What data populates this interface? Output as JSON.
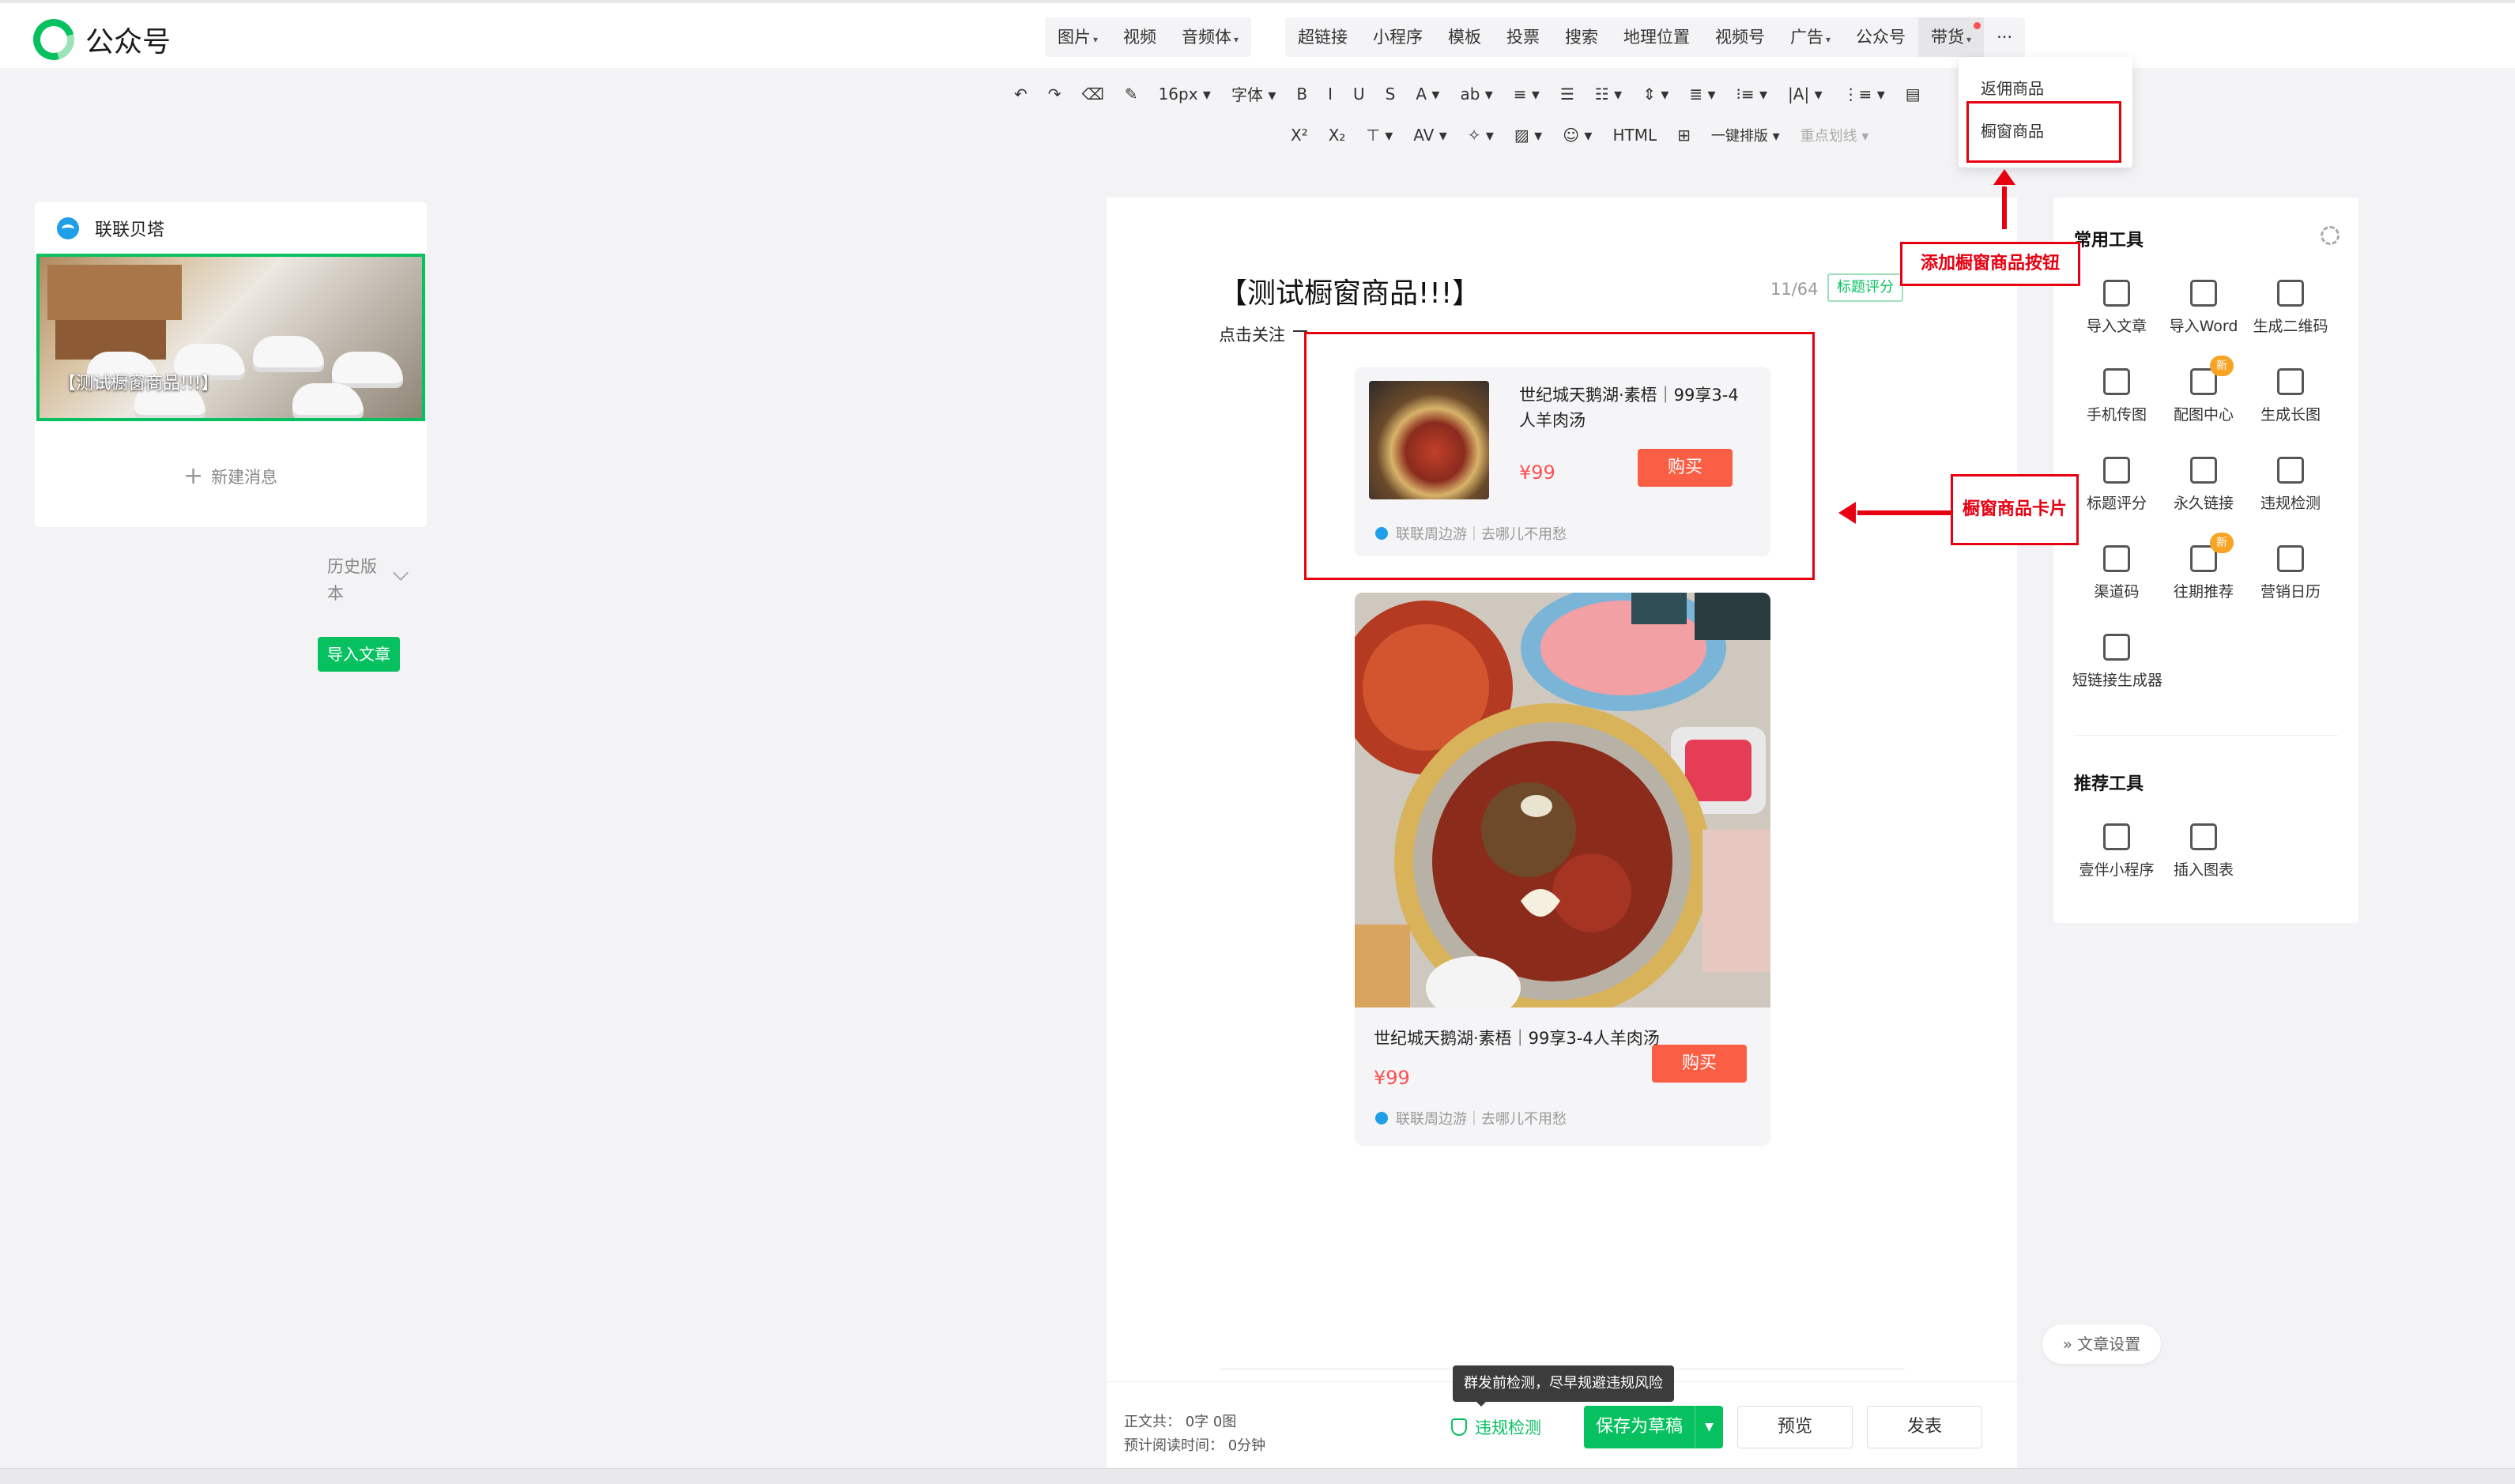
{
  "app": {
    "name": "公众号"
  },
  "nav": {
    "group1": [
      {
        "label": "图片",
        "caret": true
      },
      {
        "label": "视频",
        "caret": false
      },
      {
        "label": "音频体",
        "caret": true
      }
    ],
    "group2": [
      {
        "label": "超链接",
        "caret": false
      },
      {
        "label": "小程序",
        "caret": false
      },
      {
        "label": "模板",
        "caret": false
      },
      {
        "label": "投票",
        "caret": false
      },
      {
        "label": "搜索",
        "caret": false
      },
      {
        "label": "地理位置",
        "caret": false
      },
      {
        "label": "视频号",
        "caret": false
      },
      {
        "label": "广告",
        "caret": true
      },
      {
        "label": "公众号",
        "caret": false
      },
      {
        "label": "带货",
        "caret": true
      },
      {
        "label": "···",
        "caret": false
      }
    ]
  },
  "toolbar": {
    "row1": [
      "↶",
      "↷",
      "⌫",
      "✎",
      "16px ▾",
      "字体 ▾",
      "B",
      "I",
      "U",
      "S",
      "A ▾",
      "ab ▾",
      "≡ ▾",
      "☰",
      "☷ ▾",
      "⇕ ▾",
      "≣ ▾",
      "⁝≡ ▾",
      "|A| ▾",
      "⋮≡ ▾",
      "▤"
    ],
    "row2": [
      "X²",
      "X₂",
      "⊤ ▾",
      "AV ▾",
      "✧ ▾",
      "▨ ▾",
      "☺ ▾",
      "HTML",
      "⊞"
    ],
    "autolayout": "一键排版 ▾",
    "highlight": "重点划线 ▾"
  },
  "dropdown": {
    "items": [
      "返佣商品",
      "橱窗商品"
    ]
  },
  "left": {
    "account": "联联贝塔",
    "thumb_title": "【测试橱窗商品!!!】",
    "new_message": "新建消息",
    "history": "历史版本",
    "import_button": "导入文章"
  },
  "editor": {
    "title": "【测试橱窗商品!!!】",
    "counter": "11/64",
    "score_badge": "标题评分",
    "follow_text": "点击关注",
    "card1": {
      "name": "世纪城天鹅湖·素梧｜99享3-4人羊肉汤",
      "price": "¥99",
      "buy": "购买",
      "shop": "联联周边游｜去哪儿不用愁"
    },
    "card2": {
      "name": "世纪城天鹅湖·素梧｜99享3-4人羊肉汤",
      "price": "¥99",
      "buy": "购买",
      "shop": "联联周边游｜去哪儿不用愁"
    },
    "footer": {
      "stat1": "正文共：  0字 0图",
      "stat2": "预计阅读时间：  0分钟",
      "check": "违规检测",
      "save": "保存为草稿",
      "preview": "预览",
      "publish": "发表"
    },
    "tooltip": "群发前检测，尽早规避违规风险"
  },
  "tools": {
    "common_title": "常用工具",
    "common": [
      {
        "label": "导入文章",
        "icon": "import-icon",
        "new": false
      },
      {
        "label": "导入Word",
        "icon": "word-icon",
        "new": false
      },
      {
        "label": "生成二维码",
        "icon": "qrcode-icon",
        "new": false
      },
      {
        "label": "手机传图",
        "icon": "phone-upload-icon",
        "new": false
      },
      {
        "label": "配图中心",
        "icon": "image-center-icon",
        "new": true
      },
      {
        "label": "生成长图",
        "icon": "long-image-icon",
        "new": false
      },
      {
        "label": "标题评分",
        "icon": "title-score-icon",
        "new": false
      },
      {
        "label": "永久链接",
        "icon": "link-icon",
        "new": false
      },
      {
        "label": "违规检测",
        "icon": "shield-icon",
        "new": false
      },
      {
        "label": "渠道码",
        "icon": "channel-code-icon",
        "new": false
      },
      {
        "label": "往期推荐",
        "icon": "thumb-up-icon",
        "new": true
      },
      {
        "label": "营销日历",
        "icon": "calendar-icon",
        "new": false
      },
      {
        "label": "短链接生成器",
        "icon": "short-link-icon",
        "new": false
      }
    ],
    "new_tag": "新",
    "recommend_title": "推荐工具",
    "recommend": [
      {
        "label": "壹伴小程序",
        "icon": "miniapp-icon"
      },
      {
        "label": "插入图表",
        "icon": "chart-icon"
      }
    ],
    "article_settings": "文章设置"
  },
  "annotations": {
    "add_button": "添加橱窗商品按钮",
    "card": "橱窗商品卡片"
  },
  "colors": {
    "accent": "#07c160",
    "price": "#fa5151",
    "annotation": "#e60012"
  }
}
